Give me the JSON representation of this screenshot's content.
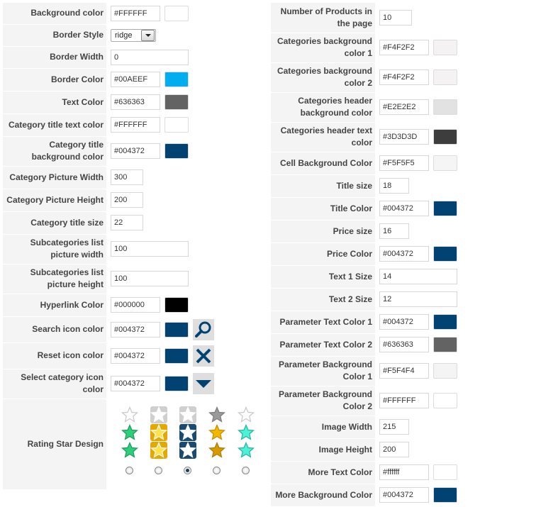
{
  "left": {
    "rows": [
      {
        "label": "Background color",
        "value": "#FFFFFF",
        "color": "#FFFFFF"
      },
      {
        "label": "Border Style",
        "value": "ridge"
      },
      {
        "label": "Border Width",
        "value": "0"
      },
      {
        "label": "Border Color",
        "value": "#00AEEF",
        "color": "#00AEEF"
      },
      {
        "label": "Text Color",
        "value": "#636363",
        "color": "#636363"
      },
      {
        "label": "Category title text color",
        "value": "#FFFFFF",
        "color": "#FFFFFF"
      },
      {
        "label": "Category title background color",
        "value": "#004372",
        "color": "#004372"
      },
      {
        "label": "Category Picture Width",
        "value": "300"
      },
      {
        "label": "Category Picture Height",
        "value": "200"
      },
      {
        "label": "Category title size",
        "value": "22"
      },
      {
        "label": "Subcategories list picture width",
        "value": "100"
      },
      {
        "label": "Subcategories list picture height",
        "value": "100"
      },
      {
        "label": "Hyperlink Color",
        "value": "#000000",
        "color": "#000000"
      },
      {
        "label": "Search icon color",
        "value": "#004372",
        "color": "#004372",
        "icon": "magnifier-icon"
      },
      {
        "label": "Reset icon color",
        "value": "#004372",
        "color": "#004372",
        "icon": "close-x-icon"
      },
      {
        "label": "Select category icon color",
        "value": "#004372",
        "color": "#004372",
        "icon": "caret-down-icon"
      },
      {
        "label": "Rating Star Design",
        "selected_option": 3
      }
    ]
  },
  "right": {
    "rows": [
      {
        "label": "Number of Products in the page",
        "value": "10"
      },
      {
        "label": "Categories background color 1",
        "value": "#F4F2F2",
        "color": "#F4F2F2"
      },
      {
        "label": "Categories background color 2",
        "value": "#F4F2F2",
        "color": "#F4F2F2"
      },
      {
        "label": "Categories header background color",
        "value": "#E2E2E2",
        "color": "#E2E2E2"
      },
      {
        "label": "Categories header text color",
        "value": "#3D3D3D",
        "color": "#3D3D3D"
      },
      {
        "label": "Cell Background Color",
        "value": "#F5F5F5",
        "color": "#F5F5F5"
      },
      {
        "label": "Title size",
        "value": "18"
      },
      {
        "label": "Title Color",
        "value": "#004372",
        "color": "#004372"
      },
      {
        "label": "Price size",
        "value": "16"
      },
      {
        "label": "Price Color",
        "value": "#004372",
        "color": "#004372"
      },
      {
        "label": "Text 1 Size",
        "value": "14"
      },
      {
        "label": "Text 2 Size",
        "value": "12"
      },
      {
        "label": "Parameter Text Color 1",
        "value": "#004372",
        "color": "#004372"
      },
      {
        "label": "Parameter Text Color 2",
        "value": "#636363",
        "color": "#636363"
      },
      {
        "label": "Parameter Background Color 1",
        "value": "#F5F4F4",
        "color": "#F5F4F4"
      },
      {
        "label": "Parameter Background Color 2",
        "value": "#FFFFFF",
        "color": "#FFFFFF"
      },
      {
        "label": "Image Width",
        "value": "215"
      },
      {
        "label": "Image Height",
        "value": "200"
      },
      {
        "label": "More Text Color",
        "value": "#ffffff",
        "color": "#ffffff"
      },
      {
        "label": "More Background Color",
        "value": "#004372",
        "color": "#004372"
      }
    ]
  }
}
